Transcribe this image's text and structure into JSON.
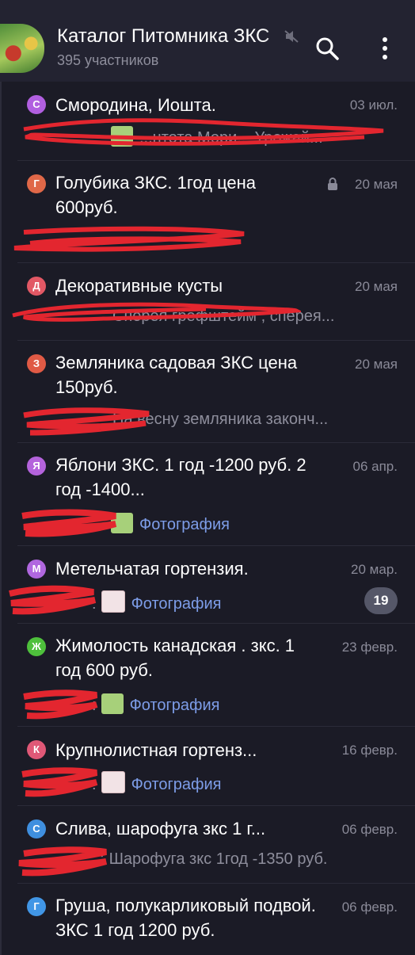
{
  "header": {
    "title": "Каталог Питомника ЗКС",
    "subtitle": "395 участников"
  },
  "chats": [
    {
      "letter": "С",
      "letter_color": "#b15fe0",
      "title": "Смородина, Иошта.",
      "date": "03 июл.",
      "preview": "",
      "preview_tail": "...нтота Мори... Урожай..."
    },
    {
      "letter": "Г",
      "letter_color": "#e06848",
      "title": "Голубика ЗКС. 1год цена 600руб.",
      "date": "20 мая",
      "preview": "",
      "preview_tail": ""
    },
    {
      "letter": "Д",
      "letter_color": "#e25865",
      "title": "Декоративные кусты",
      "date": "20 мая",
      "preview": "",
      "preview_tail": "Сперея грефштейм , сперея..."
    },
    {
      "letter": "З",
      "letter_color": "#e05a45",
      "title": "Земляника садовая ЗКС цена 150руб.",
      "date": "20 мая",
      "preview": "",
      "preview_tail": "На весну земляника законч..."
    },
    {
      "letter": "Я",
      "letter_color": "#b463dc",
      "title": "Яблони ЗКС. 1 год -1200 руб. 2 год -1400...",
      "date": "06 апр.",
      "preview": "",
      "preview_tail": "Фотография"
    },
    {
      "letter": "М",
      "letter_color": "#b067df",
      "title": "Метельчатая гортензия.",
      "date": "20 мар.",
      "preview": ":",
      "preview_tail": "Фотография",
      "unread": "19"
    },
    {
      "letter": "Ж",
      "letter_color": "#4ec03c",
      "title": "Жимолость канадская . зкс. 1 год 600 руб.",
      "date": "23 февр.",
      "preview": ":",
      "preview_tail": "Фотография"
    },
    {
      "letter": "К",
      "letter_color": "#e05877",
      "title": "Крупнолистная гортенз...",
      "date": "16 февр.",
      "preview": ":",
      "preview_tail": "Фотография"
    },
    {
      "letter": "С",
      "letter_color": "#3f8fdf",
      "title": "Слива, шарофуга зкс 1 г...",
      "date": "06 февр.",
      "preview": ":",
      "preview_tail": "Шарофуга зкс 1год -1350 руб."
    },
    {
      "letter": "Г",
      "letter_color": "#4196e6",
      "title": "Груша, полукарликовый подвой. ЗКС 1 год 1200 руб.",
      "date": "06 февр.",
      "preview": "",
      "preview_tail": ""
    }
  ]
}
